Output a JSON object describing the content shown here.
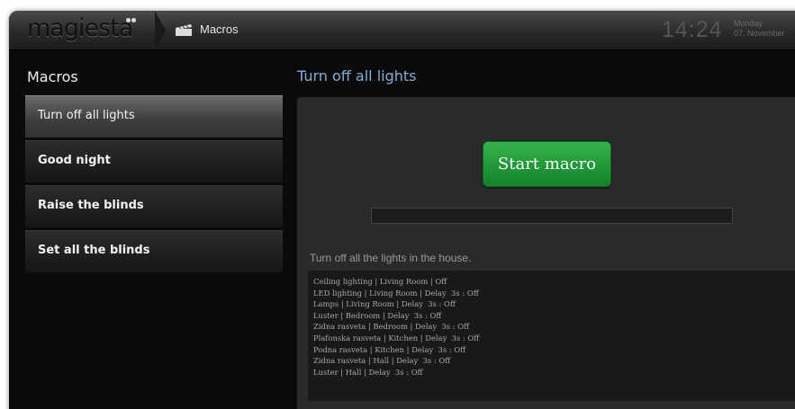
{
  "header": {
    "logo": "magiesta",
    "breadcrumb_label": "Macros",
    "breadcrumb_icon": "clapperboard-icon",
    "time": "14:24",
    "day": "Monday",
    "date": "07. November"
  },
  "sidebar": {
    "title": "Macros",
    "items": [
      {
        "label": "Turn off all lights",
        "active": true
      },
      {
        "label": "Good night",
        "active": false
      },
      {
        "label": "Raise the blinds",
        "active": false
      },
      {
        "label": "Set all the blinds",
        "active": false
      }
    ]
  },
  "detail": {
    "title": "Turn off all lights",
    "start_button": "Start macro",
    "progress": 0,
    "description": "Turn off all the lights in the house.",
    "log": [
      "Ceiling lighting | Living Room | Off",
      "LED lighting | Living Room | Delay  3s : Off",
      "Lamps | Living Room | Delay  3s : Off",
      "Luster | Bedroom | Delay  3s : Off",
      "Zidna rasveta | Bedroom | Delay  3s : Off",
      "Plafonska rasveta | Kitchen | Delay  3s : Off",
      "Podna rasveta | Kitchen | Delay  3s : Off",
      "Zidna rasveta | Hall | Delay  3s : Off",
      "Luster | Hall | Delay  3s : Off"
    ]
  },
  "colors": {
    "accent_title": "#7fb0d8",
    "start_green": "#1f9837",
    "panel_bg": "#2a2a2a"
  }
}
